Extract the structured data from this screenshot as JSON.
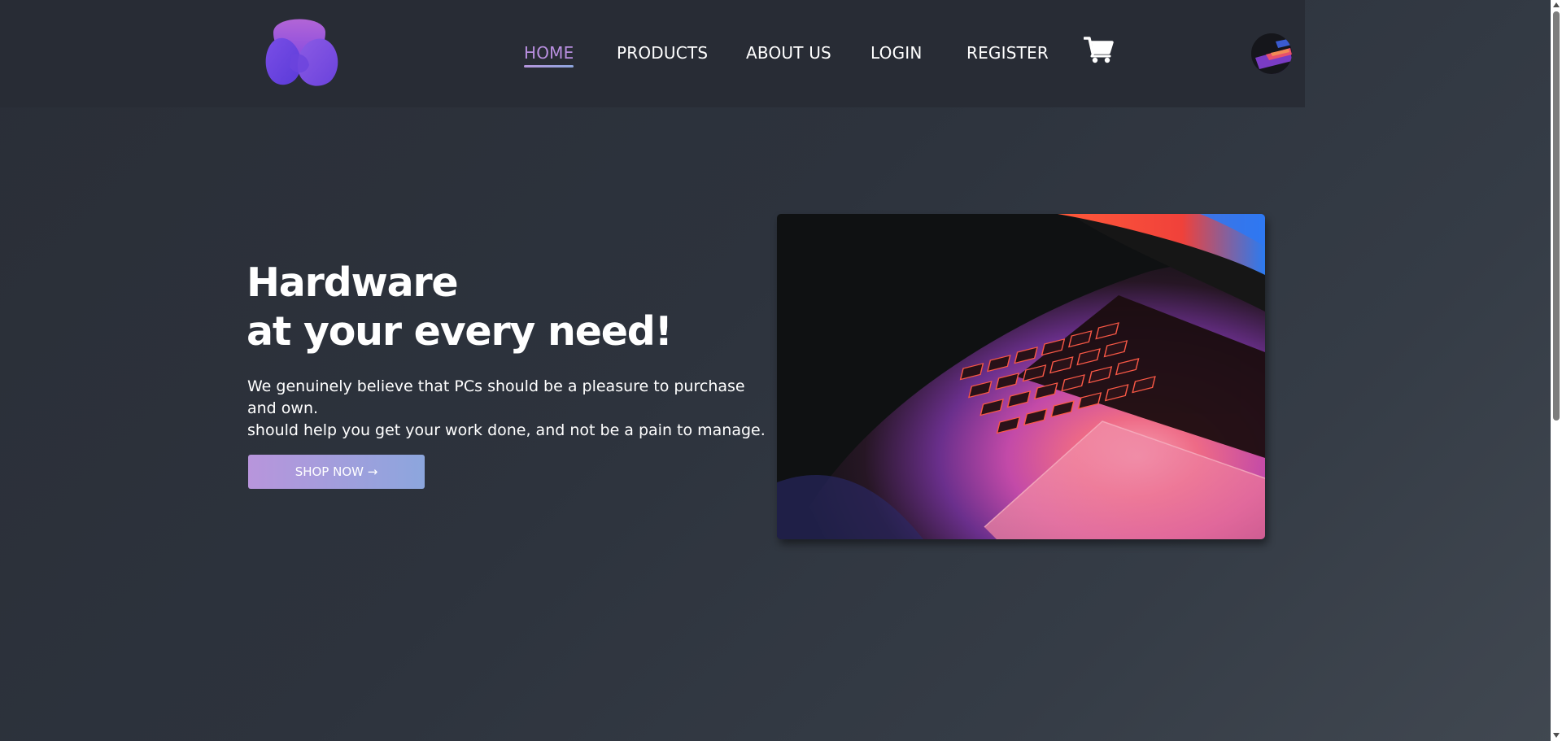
{
  "nav": {
    "items": [
      {
        "label": "HOME",
        "active": true
      },
      {
        "label": "PRODUCTS",
        "active": false
      },
      {
        "label": "ABOUT US",
        "active": false
      },
      {
        "label": "LOGIN",
        "active": false
      },
      {
        "label": "REGISTER",
        "active": false
      }
    ],
    "cart_icon": "shopping-cart-icon",
    "active_color": "#b98fe0"
  },
  "hero": {
    "title_line1": "Hardware",
    "title_line2": "at your every need!",
    "text_line1": "We genuinely believe that PCs should be a pleasure to purchase and own.",
    "text_line2": "should help you get your work done, and not be a pain to manage.",
    "button_label": "SHOP NOW →"
  },
  "colors": {
    "background": "#2d333d",
    "navbar": "#282c35",
    "button_gradient_start": "#b895dc",
    "button_gradient_end": "#8ca6dd"
  }
}
